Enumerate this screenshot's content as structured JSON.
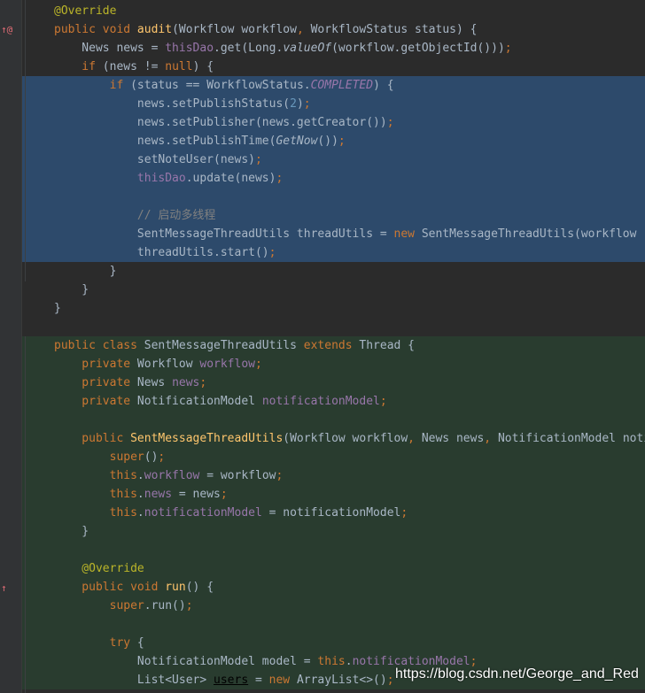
{
  "gutter": {
    "override_marker": "↑@",
    "run_marker": "↑"
  },
  "lines": [
    {
      "bg": "normal",
      "tokens": [
        [
          "ann",
          "@Override"
        ]
      ]
    },
    {
      "bg": "normal",
      "tokens": [
        [
          "kw",
          "public void "
        ],
        [
          "fn",
          "audit"
        ],
        [
          "id",
          "(Workflow workflow"
        ],
        [
          "kw",
          ", "
        ],
        [
          "id",
          "WorkflowStatus status) {"
        ]
      ]
    },
    {
      "bg": "normal",
      "tokens": [
        [
          "id",
          "    News news = "
        ],
        [
          "fld",
          "thisDao"
        ],
        [
          "id",
          ".get(Long."
        ],
        [
          "ital",
          "valueOf"
        ],
        [
          "id",
          "(workflow.getObjectId()))"
        ],
        [
          "kw",
          ";"
        ]
      ]
    },
    {
      "bg": "normal",
      "tokens": [
        [
          "kw",
          "    if "
        ],
        [
          "id",
          "(news != "
        ],
        [
          "kw",
          "null"
        ],
        [
          "id",
          ") {"
        ]
      ]
    },
    {
      "bg": "sel",
      "tokens": [
        [
          "kw",
          "        if "
        ],
        [
          "id",
          "(status "
        ],
        [
          "id",
          "== WorkflowStatus."
        ],
        [
          "fldi",
          "COMPLETED"
        ],
        [
          "id",
          ") {"
        ]
      ]
    },
    {
      "bg": "sel",
      "tokens": [
        [
          "id",
          "            news.setPublishStatus("
        ],
        [
          "num",
          "2"
        ],
        [
          "id",
          ")"
        ],
        [
          "kw",
          ";"
        ]
      ]
    },
    {
      "bg": "sel",
      "tokens": [
        [
          "id",
          "            news.setPublisher(news.getCreator())"
        ],
        [
          "kw",
          ";"
        ]
      ]
    },
    {
      "bg": "sel",
      "tokens": [
        [
          "id",
          "            news.setPublishTime("
        ],
        [
          "ital",
          "GetNow"
        ],
        [
          "id",
          "())"
        ],
        [
          "kw",
          ";"
        ]
      ]
    },
    {
      "bg": "sel",
      "tokens": [
        [
          "id",
          "            setNoteUser(news)"
        ],
        [
          "kw",
          ";"
        ]
      ]
    },
    {
      "bg": "sel",
      "tokens": [
        [
          "fld",
          "            thisDao"
        ],
        [
          "id",
          ".update(news)"
        ],
        [
          "kw",
          ";"
        ]
      ]
    },
    {
      "bg": "sel",
      "tokens": [
        [
          "id",
          " "
        ]
      ]
    },
    {
      "bg": "sel",
      "tokens": [
        [
          "cmt",
          "            // 启动多线程"
        ]
      ]
    },
    {
      "bg": "sel",
      "tokens": [
        [
          "id",
          "            SentMessageThreadUtils threadUtils = "
        ],
        [
          "kw",
          "new "
        ],
        [
          "id",
          "SentMessageThreadUtils(workflow"
        ]
      ]
    },
    {
      "bg": "sel",
      "tokens": [
        [
          "id",
          "            threadUtils.start()"
        ],
        [
          "kw",
          ";"
        ]
      ]
    },
    {
      "bg": "normal",
      "tokens": [
        [
          "id",
          "        }"
        ]
      ]
    },
    {
      "bg": "normal",
      "tokens": [
        [
          "id",
          "    }"
        ]
      ]
    },
    {
      "bg": "normal",
      "tokens": [
        [
          "id",
          "}"
        ]
      ]
    },
    {
      "bg": "normal",
      "tokens": [
        [
          "id",
          " "
        ]
      ]
    },
    {
      "bg": "block",
      "tokens": [
        [
          "kw",
          "public class "
        ],
        [
          "id",
          "SentMessageThreadUtils "
        ],
        [
          "kw",
          "extends "
        ],
        [
          "id",
          "Thread {"
        ]
      ]
    },
    {
      "bg": "block",
      "tokens": [
        [
          "kw",
          "    private "
        ],
        [
          "id",
          "Workflow "
        ],
        [
          "fld",
          "workflow"
        ],
        [
          "kw",
          ";"
        ]
      ]
    },
    {
      "bg": "block",
      "tokens": [
        [
          "kw",
          "    private "
        ],
        [
          "id",
          "News "
        ],
        [
          "fld",
          "news"
        ],
        [
          "kw",
          ";"
        ]
      ]
    },
    {
      "bg": "block",
      "tokens": [
        [
          "kw",
          "    private "
        ],
        [
          "id",
          "NotificationModel "
        ],
        [
          "fld",
          "notificationModel"
        ],
        [
          "kw",
          ";"
        ]
      ]
    },
    {
      "bg": "block",
      "tokens": [
        [
          "id",
          " "
        ]
      ]
    },
    {
      "bg": "block",
      "tokens": [
        [
          "kw",
          "    public "
        ],
        [
          "fn",
          "SentMessageThreadUtils"
        ],
        [
          "id",
          "(Workflow workflow"
        ],
        [
          "kw",
          ", "
        ],
        [
          "id",
          "News news"
        ],
        [
          "kw",
          ", "
        ],
        [
          "id",
          "NotificationModel notificationModel"
        ]
      ]
    },
    {
      "bg": "block",
      "tokens": [
        [
          "kw",
          "        super"
        ],
        [
          "id",
          "()"
        ],
        [
          "kw",
          ";"
        ]
      ]
    },
    {
      "bg": "block",
      "tokens": [
        [
          "kw",
          "        this"
        ],
        [
          "id",
          "."
        ],
        [
          "fld",
          "workflow"
        ],
        [
          "id",
          " = workflow"
        ],
        [
          "kw",
          ";"
        ]
      ]
    },
    {
      "bg": "block",
      "tokens": [
        [
          "kw",
          "        this"
        ],
        [
          "id",
          "."
        ],
        [
          "fld",
          "news"
        ],
        [
          "id",
          " = news"
        ],
        [
          "kw",
          ";"
        ]
      ]
    },
    {
      "bg": "block",
      "tokens": [
        [
          "kw",
          "        this"
        ],
        [
          "id",
          "."
        ],
        [
          "fld",
          "notificationModel"
        ],
        [
          "id",
          " = notificationModel"
        ],
        [
          "kw",
          ";"
        ]
      ]
    },
    {
      "bg": "block",
      "tokens": [
        [
          "id",
          "    }"
        ]
      ]
    },
    {
      "bg": "block",
      "tokens": [
        [
          "id",
          " "
        ]
      ]
    },
    {
      "bg": "block",
      "tokens": [
        [
          "ann",
          "    @Override"
        ]
      ]
    },
    {
      "bg": "block",
      "tokens": [
        [
          "kw",
          "    public void "
        ],
        [
          "fn",
          "run"
        ],
        [
          "id",
          "() {"
        ]
      ]
    },
    {
      "bg": "block",
      "tokens": [
        [
          "kw",
          "        super"
        ],
        [
          "id",
          ".run()"
        ],
        [
          "kw",
          ";"
        ]
      ]
    },
    {
      "bg": "block",
      "tokens": [
        [
          "id",
          " "
        ]
      ]
    },
    {
      "bg": "block",
      "tokens": [
        [
          "kw",
          "        try "
        ],
        [
          "id",
          "{"
        ]
      ]
    },
    {
      "bg": "block",
      "tokens": [
        [
          "id",
          "            NotificationModel model = "
        ],
        [
          "kw",
          "this"
        ],
        [
          "id",
          "."
        ],
        [
          "fld",
          "notificationModel"
        ],
        [
          "kw",
          ";"
        ]
      ]
    },
    {
      "bg": "block",
      "tokens": [
        [
          "id",
          "            List<User> "
        ],
        [
          "u",
          "users"
        ],
        [
          "id",
          " = "
        ],
        [
          "kw",
          "new "
        ],
        [
          "id",
          "ArrayList<>()"
        ],
        [
          "kw",
          ";"
        ]
      ]
    }
  ],
  "watermark": "https://blog.csdn.net/George_and_Red"
}
